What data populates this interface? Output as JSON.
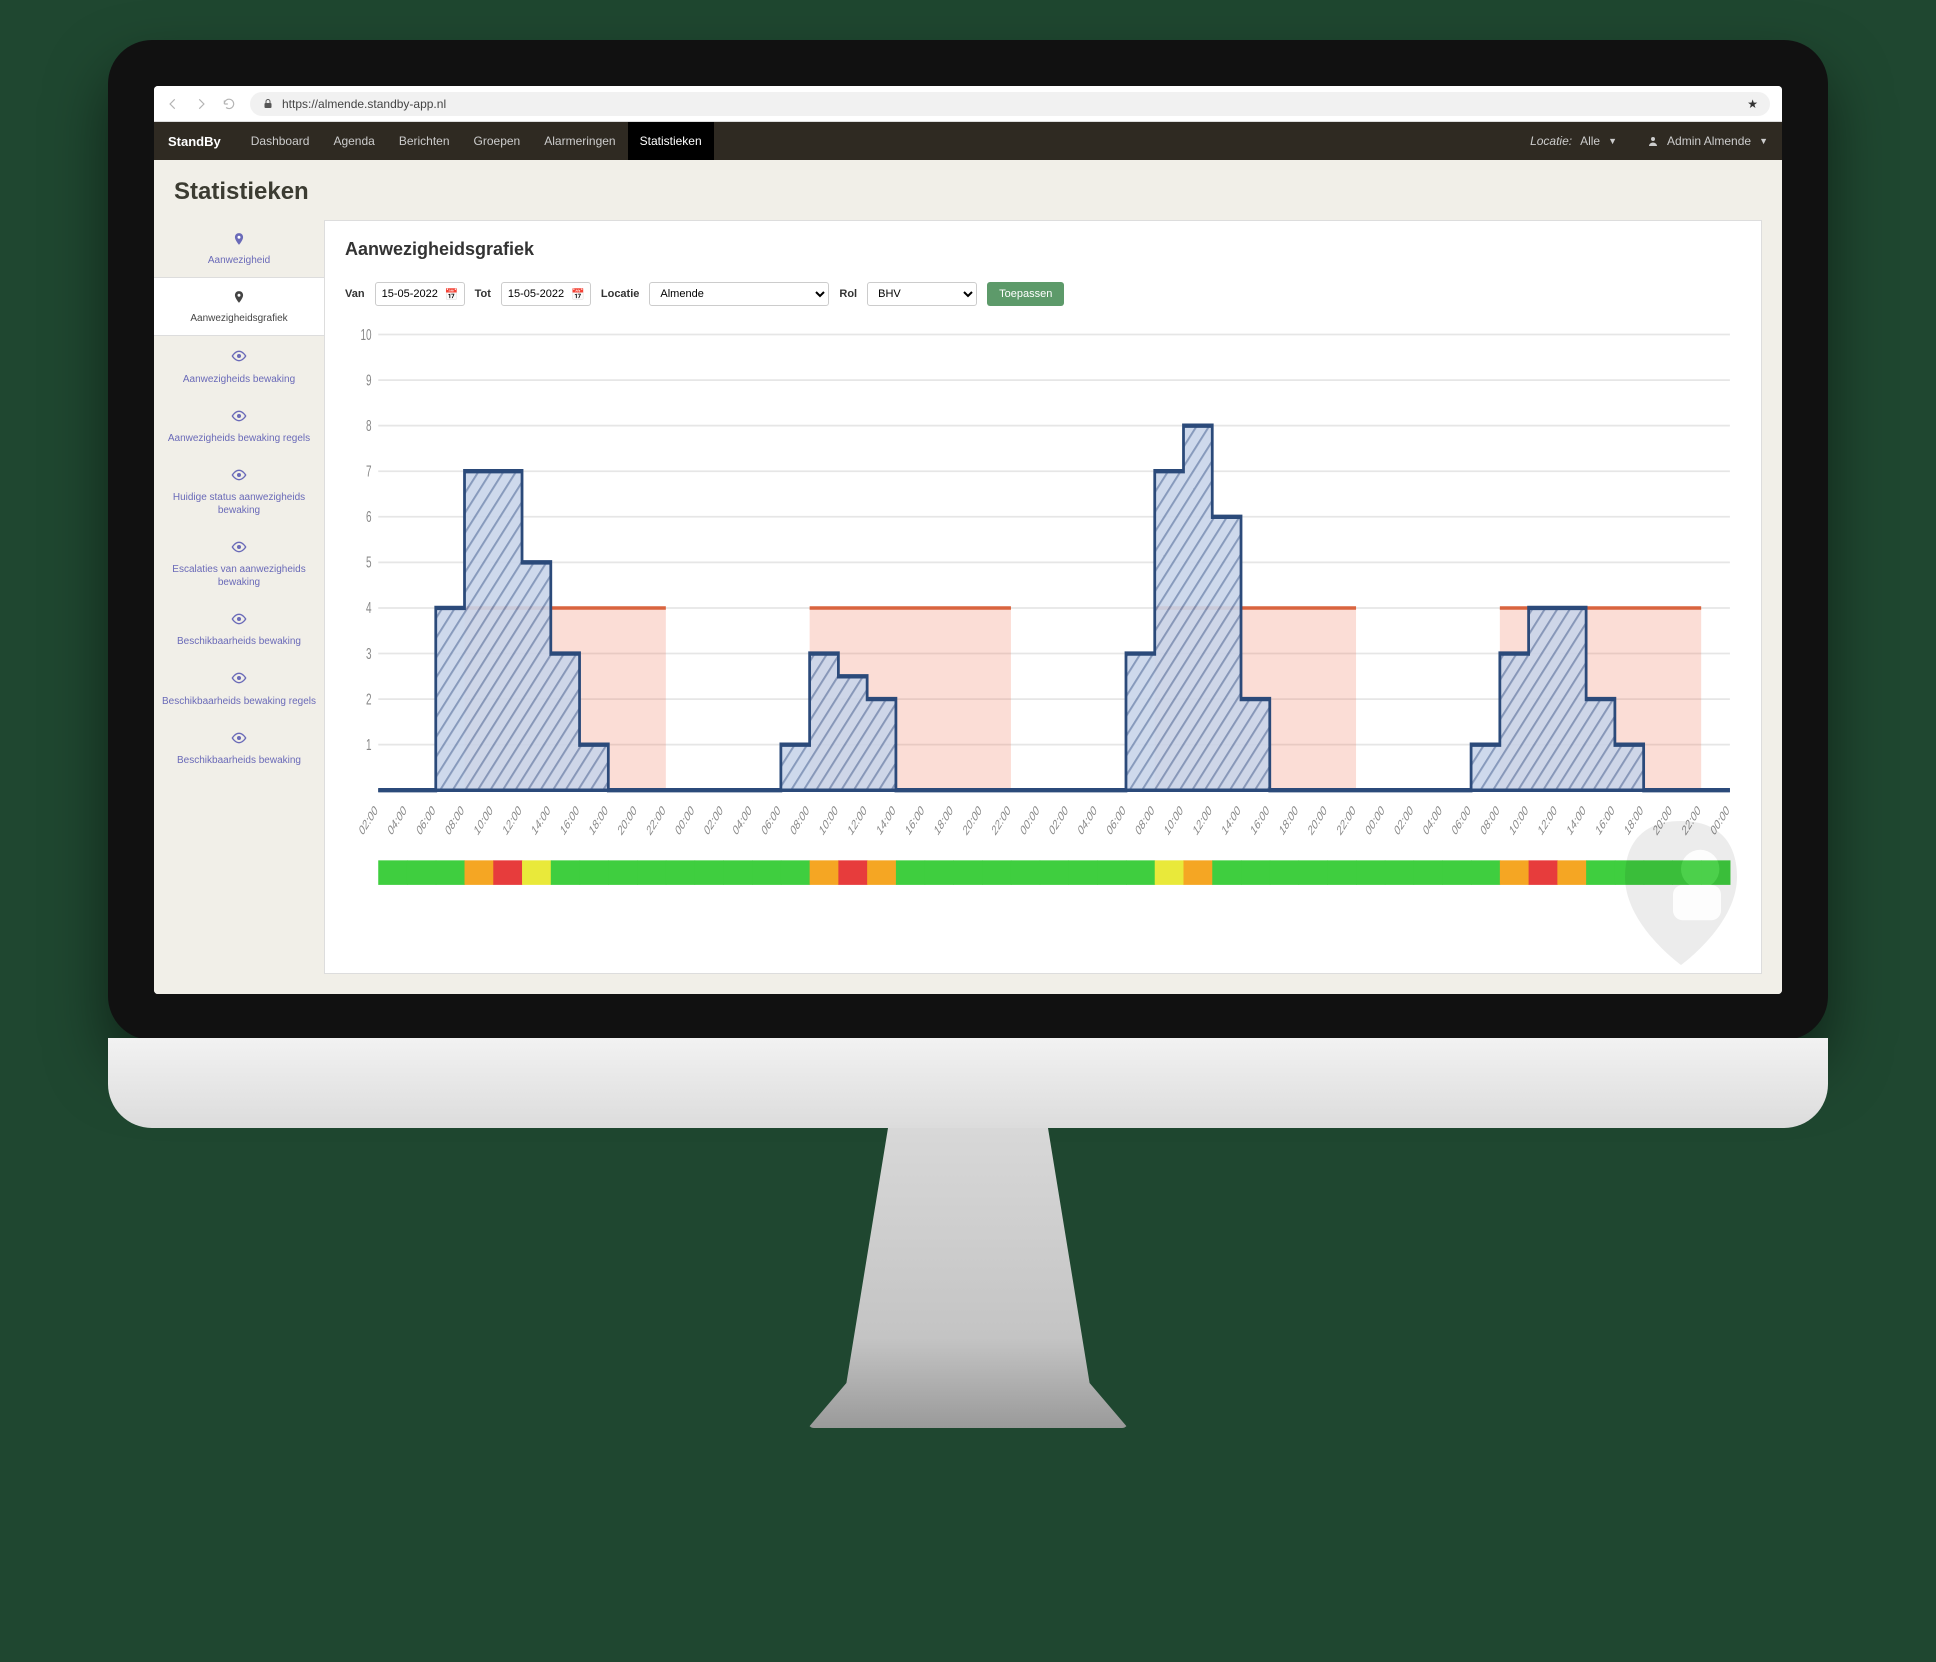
{
  "browser": {
    "url": "https://almende.standby-app.nl"
  },
  "nav": {
    "brand": "StandBy",
    "items": [
      "Dashboard",
      "Agenda",
      "Berichten",
      "Groepen",
      "Alarmeringen",
      "Statistieken"
    ],
    "active": 5,
    "locationLabel": "Locatie:",
    "locationValue": "Alle",
    "user": "Admin Almende"
  },
  "page": {
    "title": "Statistieken"
  },
  "sidebar": {
    "items": [
      {
        "icon": "pin",
        "label": "Aanwezigheid"
      },
      {
        "icon": "pin",
        "label": "Aanwezigheidsgrafiek"
      },
      {
        "icon": "eye",
        "label": "Aanwezigheids bewaking"
      },
      {
        "icon": "eye",
        "label": "Aanwezigheids bewaking regels"
      },
      {
        "icon": "eye",
        "label": "Huidige status aanwezigheids bewaking"
      },
      {
        "icon": "eye",
        "label": "Escalaties van aanwezigheids bewaking"
      },
      {
        "icon": "eye",
        "label": "Beschikbaarheids bewaking"
      },
      {
        "icon": "eye",
        "label": "Beschikbaarheids bewaking regels"
      },
      {
        "icon": "eye",
        "label": "Beschikbaarheids bewaking"
      }
    ],
    "active": 1
  },
  "main": {
    "heading": "Aanwezigheidsgrafiek",
    "filters": {
      "vanLabel": "Van",
      "van": "15-05-2022",
      "totLabel": "Tot",
      "tot": "15-05-2022",
      "locatieLabel": "Locatie",
      "locatie": "Almende",
      "rolLabel": "Rol",
      "rol": "BHV",
      "apply": "Toepassen"
    }
  },
  "chart_data": {
    "type": "line",
    "ylim": [
      0,
      10
    ],
    "yticks": [
      1,
      2,
      3,
      4,
      5,
      6,
      7,
      8,
      9,
      10
    ],
    "threshold": 4,
    "xticks": [
      "02:00",
      "04:00",
      "06:00",
      "08:00",
      "10:00",
      "12:00",
      "14:00",
      "16:00",
      "18:00",
      "20:00",
      "22:00",
      "00:00",
      "02:00",
      "04:00",
      "06:00",
      "08:00",
      "10:00",
      "12:00",
      "14:00",
      "16:00",
      "18:00",
      "20:00",
      "22:00",
      "00:00",
      "02:00",
      "04:00",
      "06:00",
      "08:00",
      "10:00",
      "12:00",
      "14:00",
      "16:00",
      "18:00",
      "20:00",
      "22:00",
      "00:00",
      "02:00",
      "04:00",
      "06:00",
      "08:00",
      "10:00",
      "12:00",
      "14:00",
      "16:00",
      "18:00",
      "20:00",
      "22:00",
      "00:00"
    ],
    "threshold_windows": [
      {
        "start": 3,
        "end": 10
      },
      {
        "start": 15,
        "end": 22
      },
      {
        "start": 27,
        "end": 34
      },
      {
        "start": 39,
        "end": 46
      }
    ],
    "days": [
      {
        "offset": 0,
        "values": [
          0,
          0,
          0,
          0,
          2,
          4,
          6,
          7,
          6.5,
          7,
          5,
          4,
          3,
          2,
          1,
          1,
          0,
          0,
          0,
          0,
          0,
          0,
          0,
          0
        ],
        "heat": [
          "g",
          "g",
          "g",
          "g",
          "g",
          "g",
          "y",
          "o",
          "r",
          "o",
          "y",
          "g",
          "g",
          "g",
          "g",
          "g",
          "g",
          "g",
          "g",
          "g",
          "g",
          "g",
          "g",
          "g"
        ]
      },
      {
        "offset": 12,
        "values": [
          0,
          0,
          0,
          0,
          0,
          1,
          2,
          3,
          2.5,
          2,
          2,
          1,
          0,
          0,
          0,
          0,
          0,
          0,
          0,
          0,
          0,
          0,
          0,
          0
        ],
        "heat": [
          "g",
          "g",
          "g",
          "g",
          "g",
          "g",
          "y",
          "o",
          "r",
          "r",
          "o",
          "y",
          "g",
          "g",
          "g",
          "g",
          "g",
          "g",
          "g",
          "g",
          "g",
          "g",
          "g",
          "g"
        ]
      },
      {
        "offset": 24,
        "values": [
          0,
          0,
          0,
          0,
          0,
          3,
          6,
          7,
          6,
          8,
          6,
          4,
          2,
          1,
          0,
          0,
          0,
          0,
          0,
          0,
          0,
          0,
          0,
          0
        ],
        "heat": [
          "g",
          "g",
          "g",
          "g",
          "g",
          "g",
          "g",
          "y",
          "o",
          "y",
          "g",
          "g",
          "g",
          "g",
          "g",
          "g",
          "g",
          "g",
          "g",
          "g",
          "g",
          "g",
          "g",
          "g"
        ]
      },
      {
        "offset": 36,
        "values": [
          0,
          0,
          0,
          0,
          0,
          1,
          2,
          3,
          3,
          4,
          4,
          3,
          2,
          0,
          1,
          0,
          0,
          0,
          0,
          0,
          0,
          0,
          0,
          0
        ],
        "heat": [
          "g",
          "g",
          "g",
          "g",
          "g",
          "g",
          "y",
          "o",
          "r",
          "o",
          "o",
          "y",
          "g",
          "g",
          "g",
          "g",
          "g",
          "g",
          "g",
          "g",
          "g",
          "g",
          "g",
          "g"
        ]
      }
    ]
  }
}
